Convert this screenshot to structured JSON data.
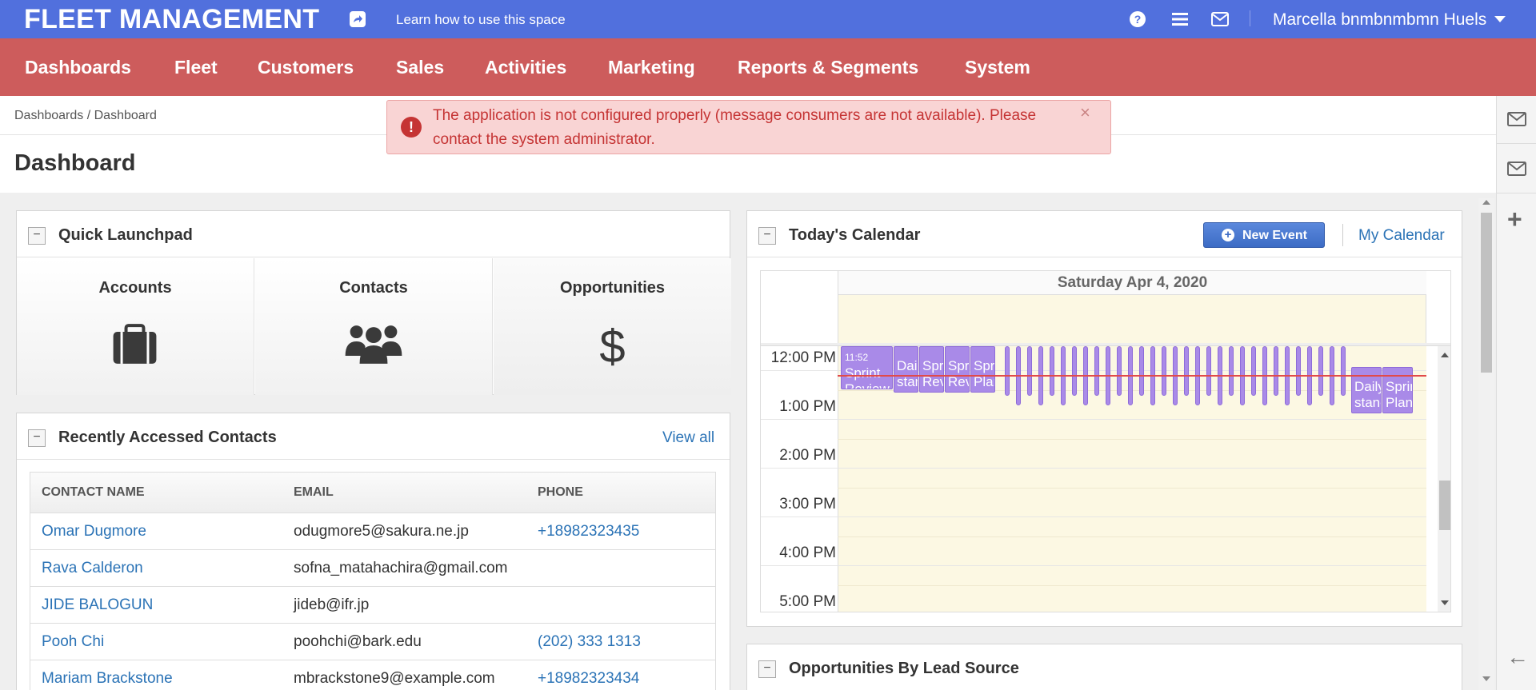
{
  "topbar": {
    "logo": "FLEET MANAGEMENT",
    "learn": "Learn how to use this space",
    "user": "Marcella bnmbnmbmn Huels"
  },
  "nav": [
    "Dashboards",
    "Fleet",
    "Customers",
    "Sales",
    "Activities",
    "Marketing",
    "Reports & Segments",
    "System"
  ],
  "breadcrumb": "Dashboards / Dashboard",
  "page_title": "Dashboard",
  "alert": {
    "icon": "!",
    "message": "The application is not configured properly (message consumers are not available). Please contact the system administrator.",
    "close": "×"
  },
  "launchpad": {
    "title": "Quick Launchpad",
    "items": [
      "Accounts",
      "Contacts",
      "Opportunities"
    ]
  },
  "contacts": {
    "title": "Recently Accessed Contacts",
    "view_all": "View all",
    "headers": [
      "CONTACT NAME",
      "EMAIL",
      "PHONE"
    ],
    "rows": [
      {
        "name": "Omar Dugmore",
        "email": "odugmore5@sakura.ne.jp",
        "phone": "+18982323435"
      },
      {
        "name": "Rava Calderon",
        "email": "sofna_matahachira@gmail.com",
        "phone": ""
      },
      {
        "name": "JIDE BALOGUN",
        "email": "jideb@ifr.jp",
        "phone": ""
      },
      {
        "name": "Pooh Chi",
        "email": "poohchi@bark.edu",
        "phone": "(202) 333 1313"
      },
      {
        "name": "Mariam Brackstone",
        "email": "mbrackstone9@example.com",
        "phone": "+18982323434"
      }
    ]
  },
  "calendar": {
    "title": "Today's Calendar",
    "new_event": "New Event",
    "my_calendar": "My Calendar",
    "day": "Saturday Apr 4, 2020",
    "times": [
      "12:00 PM",
      "1:00 PM",
      "2:00 PM",
      "3:00 PM",
      "4:00 PM",
      "5:00 PM"
    ],
    "events": {
      "e1": "Sprint Review",
      "e1_time": "11:52",
      "e2": "Daily stand",
      "e3": "Sprint Review",
      "e4": "Sprint Review",
      "e5": "Sprint Plan",
      "e6": "Daily stand",
      "e7": "Sprint Plan"
    }
  },
  "opportunities": {
    "title": "Opportunities By Lead Source"
  },
  "icons": {
    "collapse": "−",
    "plus": "+",
    "back": "←",
    "new_event": "+"
  },
  "colors": {
    "topbar": "#5170dd",
    "navbar": "#cd5c5c",
    "link": "#2b73b6",
    "event": "#a98ae8",
    "alert_bg": "#f9d4d4"
  }
}
